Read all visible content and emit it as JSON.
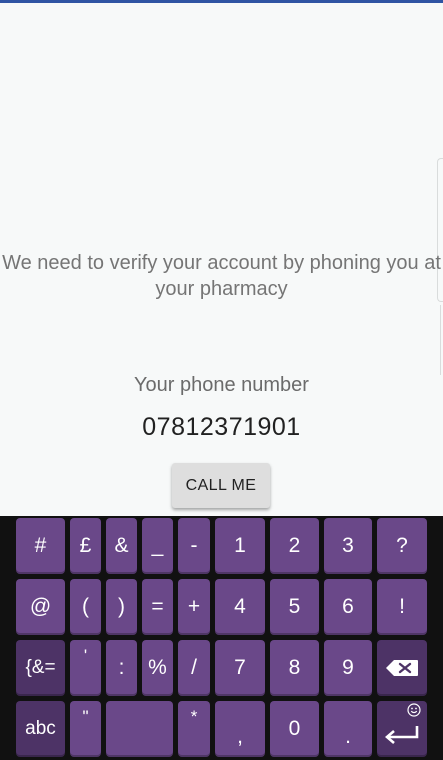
{
  "message": "We need to verify your account by phoning you at your pharmacy",
  "phone_label": "Your phone number",
  "phone_number": "07812371901",
  "call_button": "CALL ME",
  "keyboard": {
    "row1": [
      "#",
      "£",
      "&",
      "_",
      "-",
      "1",
      "2",
      "3",
      "?"
    ],
    "row2": [
      "@",
      "(",
      ")",
      "=",
      "+",
      "4",
      "5",
      "6",
      "!"
    ],
    "row3": [
      "{&=",
      "'",
      ":",
      "%",
      "/",
      "7",
      "8",
      "9"
    ],
    "row4": [
      "abc",
      "\"",
      "*",
      ",",
      "0",
      "."
    ],
    "backspace_icon": "backspace-icon",
    "enter_icon": "enter-icon",
    "emoji_icon": "emoji-icon"
  },
  "colors": {
    "accent_bar": "#2f54a3",
    "key": "#6a4889",
    "key_dark": "#4d3366",
    "keyboard_bg": "#111111"
  }
}
